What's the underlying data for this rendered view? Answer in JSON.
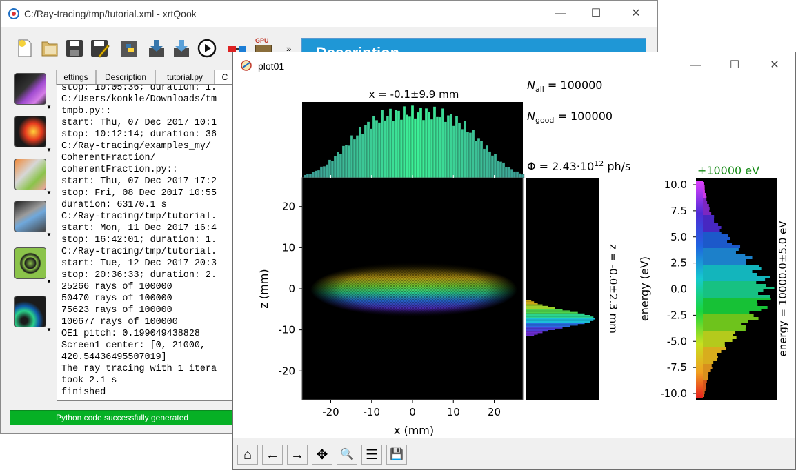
{
  "main_window": {
    "title": "C:/Ray-tracing/tmp/tutorial.xml - xrtQook",
    "minimize": "—",
    "maximize": "☐",
    "close": "✕",
    "toolbar_more": "»",
    "gpu_label": "GPU",
    "description_title": "Description",
    "tabs": [
      "ettings",
      "Description",
      "tutorial.py",
      "C"
    ],
    "console_lines": [
      "stop: 10:05:36; duration: 1.",
      "C:/Users/konkle/Downloads/tm",
      "tmpb.py::",
      "start: Thu, 07 Dec 2017 10:1",
      "stop: 10:12:14; duration: 36",
      "C:/Ray-tracing/examples_my/",
      "CoherentFraction/",
      "coherentFraction.py::",
      "start: Thu, 07 Dec 2017 17:2",
      "stop: Fri, 08 Dec 2017 10:55",
      "duration: 63170.1 s",
      "C:/Ray-tracing/tmp/tutorial.",
      "start: Mon, 11 Dec 2017 16:4",
      "stop: 16:42:01; duration: 1.",
      "C:/Ray-tracing/tmp/tutorial.",
      "start: Tue, 12 Dec 2017 20:3",
      "stop: 20:36:33; duration: 2.",
      "25266 rays of 100000",
      "50470 rays of 100000",
      "75623 rays of 100000",
      "100677 rays of 100000",
      "OE1 pitch: 0.199049438828",
      "Screen1 center: [0, 21000,",
      "420.54436495507019]",
      "The ray tracing with 1 itera",
      "took 2.1 s",
      "finished"
    ],
    "status": "Python code successfully generated"
  },
  "plot_window": {
    "title": "plot01",
    "minimize": "—",
    "maximize": "☐",
    "close": "✕",
    "nav_buttons": [
      "⌂",
      "←",
      "→",
      "✥",
      "🔍",
      "☰",
      "💾"
    ]
  },
  "plot": {
    "top_label": "x = -0.1±9.9 mm",
    "n_all_label": "N",
    "n_all_sub": "all",
    "n_all_value": " = 100000",
    "n_good_label": "N",
    "n_good_sub": "good",
    "n_good_value": " = 100000",
    "flux_prefix": "Φ = 2.43·10",
    "flux_exp": "12",
    "flux_suffix": " ph/s",
    "energy_offset": "+10000 eV",
    "x_axis_label": "x (mm)",
    "z_axis_label": "z (mm)",
    "side_label": "z = -0.0±2.3 mm",
    "energy_axis_label": "energy (eV)",
    "energy_side_label": "energy = 10000.0±5.0 eV",
    "x_ticks": [
      "-20",
      "-10",
      "0",
      "10",
      "20"
    ],
    "z_ticks": [
      "20",
      "10",
      "0",
      "-10",
      "-20"
    ],
    "energy_ticks": [
      "10.0",
      "7.5",
      "5.0",
      "2.5",
      "0.0",
      "-2.5",
      "-5.0",
      "-7.5",
      "-10.0"
    ]
  },
  "colors": {
    "accent": "#1f97d6",
    "status_green": "#06b025",
    "energy_label_green": "#1a8c1a"
  }
}
